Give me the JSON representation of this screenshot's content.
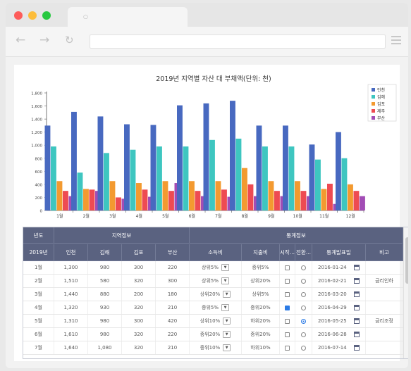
{
  "chart_data": {
    "type": "bar",
    "title": "2019년 지역별 자산 대 부채액(단위: 천)",
    "categories": [
      "1월",
      "2월",
      "3월",
      "4월",
      "5월",
      "6월",
      "7월",
      "8월",
      "9월",
      "10월",
      "11월",
      "12월"
    ],
    "ylim": [
      0,
      1800
    ],
    "yticks": [
      "0",
      "200",
      "400",
      "600",
      "800",
      "1,000",
      "1,200",
      "1,400",
      "1,600",
      "1,800"
    ],
    "legend_position": "top-right",
    "series": [
      {
        "name": "인천",
        "color": "#4869c0",
        "values": [
          1300,
          1510,
          1440,
          1320,
          1310,
          1610,
          1640,
          1680,
          1300,
          1300,
          1010,
          1200
        ]
      },
      {
        "name": "김해",
        "color": "#3ec6c0",
        "values": [
          980,
          580,
          880,
          930,
          980,
          980,
          1080,
          1100,
          980,
          980,
          780,
          800
        ]
      },
      {
        "name": "김포",
        "color": "#f39a30",
        "values": [
          450,
          330,
          450,
          420,
          450,
          450,
          450,
          650,
          450,
          450,
          330,
          400
        ]
      },
      {
        "name": "제주",
        "color": "#ee4b52",
        "values": [
          300,
          320,
          200,
          320,
          300,
          300,
          320,
          400,
          300,
          300,
          410,
          300
        ]
      },
      {
        "name": "부산",
        "color": "#a24db5",
        "values": [
          220,
          300,
          180,
          210,
          420,
          220,
          210,
          220,
          220,
          220,
          100,
          220
        ]
      }
    ]
  },
  "grid": {
    "group_headers": {
      "year": "년도",
      "region": "지역정보",
      "stats": "통계정보"
    },
    "columns": {
      "year": "2019년",
      "incheon": "인천",
      "gimhae": "김해",
      "gimpo": "김포",
      "busan": "부산",
      "income": "소득비",
      "expense": "지출비",
      "start": "시작...",
      "switch": "전환...",
      "date": "통계발표일",
      "note": "비고"
    },
    "rows": [
      {
        "month": "1월",
        "incheon": "1,300",
        "gimhae": "980",
        "gimpo": "300",
        "busan": "220",
        "income": "상위5%",
        "expense": "중위5%",
        "checked": false,
        "radio": false,
        "date": "2016-01-24",
        "note": ""
      },
      {
        "month": "2월",
        "incheon": "1,510",
        "gimhae": "580",
        "gimpo": "320",
        "busan": "300",
        "income": "상위5%",
        "expense": "상위20%",
        "checked": false,
        "radio": false,
        "date": "2016-02-21",
        "note": "금리인하"
      },
      {
        "month": "3월",
        "incheon": "1,440",
        "gimhae": "880",
        "gimpo": "200",
        "busan": "180",
        "income": "상위20%",
        "expense": "상위5%",
        "checked": false,
        "radio": false,
        "date": "2016-03-20",
        "note": ""
      },
      {
        "month": "4월",
        "incheon": "1,320",
        "gimhae": "930",
        "gimpo": "320",
        "busan": "210",
        "income": "중위5%",
        "expense": "중위20%",
        "checked": true,
        "radio": false,
        "date": "2016-04-29",
        "note": ""
      },
      {
        "month": "5월",
        "incheon": "1,310",
        "gimhae": "980",
        "gimpo": "300",
        "busan": "420",
        "income": "상위10%",
        "expense": "하위20%",
        "checked": false,
        "radio": true,
        "date": "2016-05-25",
        "note": "금리조정"
      },
      {
        "month": "6월",
        "incheon": "1,610",
        "gimhae": "980",
        "gimpo": "320",
        "busan": "220",
        "income": "중위20%",
        "expense": "중위20%",
        "checked": false,
        "radio": false,
        "date": "2016-06-28",
        "note": ""
      },
      {
        "month": "7월",
        "incheon": "1,640",
        "gimhae": "1,080",
        "gimpo": "320",
        "busan": "210",
        "income": "중위10%",
        "expense": "하위10%",
        "checked": false,
        "radio": false,
        "date": "2016-07-14",
        "note": ""
      }
    ]
  }
}
